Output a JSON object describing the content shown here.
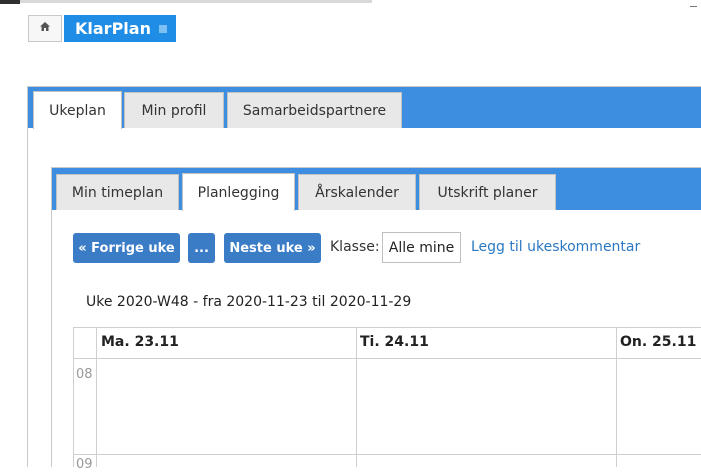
{
  "breadcrumb": {
    "home_icon": "home-icon",
    "app_name": "KlarPlan"
  },
  "outer_tabs": [
    {
      "label": "Ukeplan",
      "active": true
    },
    {
      "label": "Min profil",
      "active": false
    },
    {
      "label": "Samarbeidspartnere",
      "active": false
    }
  ],
  "inner_tabs": [
    {
      "label": "Min timeplan",
      "active": false
    },
    {
      "label": "Planlegging",
      "active": true
    },
    {
      "label": "Årskalender",
      "active": false
    },
    {
      "label": "Utskrift planer",
      "active": false
    }
  ],
  "toolbar": {
    "prev_label": "« Forrige uke",
    "dots_label": "...",
    "next_label": "Neste uke »",
    "class_label": "Klasse:",
    "class_value": "Alle mine",
    "add_comment_label": "Legg til ukeskommentar"
  },
  "week": {
    "title": "Uke 2020-W48 - fra 2020-11-23 til 2020-11-29"
  },
  "calendar": {
    "days": [
      "Ma. 23.11",
      "Ti. 24.11",
      "On. 25.11"
    ],
    "times": [
      "08",
      "09"
    ]
  },
  "colors": {
    "accent": "#3d8de0",
    "brand": "#1f8ce6",
    "button": "#3a7cc6",
    "link": "#2b78c2"
  }
}
